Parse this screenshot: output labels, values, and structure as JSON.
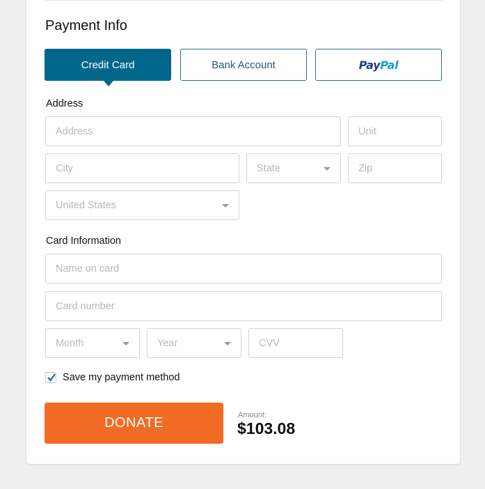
{
  "payment": {
    "title": "Payment Info",
    "tabs": [
      {
        "label": "Credit Card",
        "active": true
      },
      {
        "label": "Bank Account",
        "active": false
      },
      {
        "label_pay": "Pay",
        "label_pal": "Pal",
        "name": "PayPal",
        "active": false
      }
    ]
  },
  "address": {
    "label": "Address",
    "address_placeholder": "Address",
    "unit_placeholder": "Unit",
    "city_placeholder": "City",
    "state_placeholder": "State",
    "zip_placeholder": "Zip",
    "country_value": "United States"
  },
  "card": {
    "label": "Card Information",
    "name_placeholder": "Name on card",
    "number_placeholder": "Card number",
    "month_placeholder": "Month",
    "year_placeholder": "Year",
    "cvv_placeholder": "CVV"
  },
  "save": {
    "label": "Save my payment method",
    "checked": true
  },
  "donate": {
    "button_label": "DONATE",
    "amount_label": "Amount:",
    "amount_value": "$103.08"
  },
  "colors": {
    "accent": "#00678a",
    "donate": "#f26b24"
  }
}
